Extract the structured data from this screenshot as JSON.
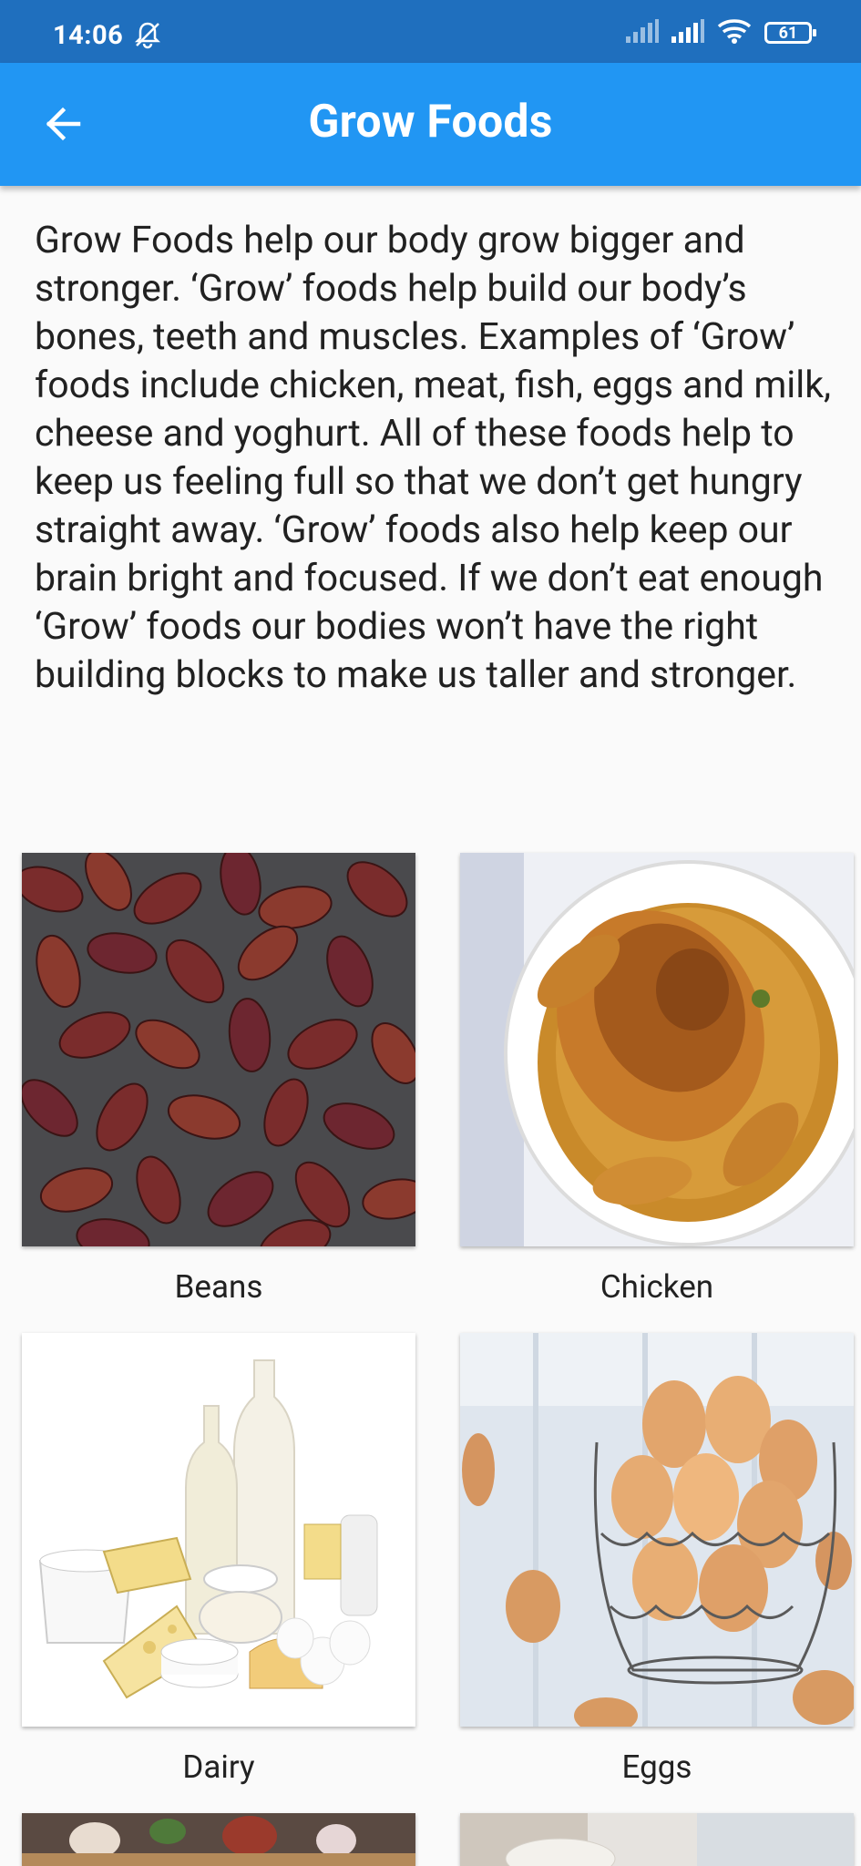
{
  "status_bar": {
    "time": "14:06",
    "battery": "61"
  },
  "app_bar": {
    "title": "Grow Foods"
  },
  "description": "Grow Foods help our body grow bigger and stronger. ‘Grow’ foods help build our body’s bones, teeth and muscles. Examples of ‘Grow’ foods include chicken, meat, fish, eggs and milk, cheese and yoghurt. All of these foods help to keep us feeling full so that we don’t get hungry straight away. ‘Grow’ foods also help keep our brain bright and focused. If we don’t eat enough ‘Grow’ foods our bodies won’t have the right building blocks to make us taller and stronger.",
  "grid": {
    "items": [
      {
        "label": "Beans"
      },
      {
        "label": "Chicken"
      },
      {
        "label": "Dairy"
      },
      {
        "label": "Eggs"
      }
    ]
  },
  "colors": {
    "status_bar": "#1f6fbe",
    "app_bar": "#2196f3",
    "background": "#fafafa"
  }
}
